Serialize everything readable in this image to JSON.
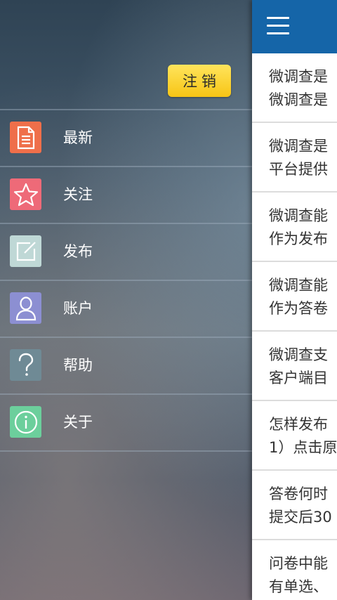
{
  "drawer": {
    "logout_label": "注销",
    "items": [
      {
        "label": "最新",
        "icon": "document-icon",
        "color": "#ef6f4a"
      },
      {
        "label": "关注",
        "icon": "star-icon",
        "color": "#ee6a78"
      },
      {
        "label": "发布",
        "icon": "edit-icon",
        "color": "#bfd8d6"
      },
      {
        "label": "账户",
        "icon": "user-icon",
        "color": "#8c8fd2"
      },
      {
        "label": "帮助",
        "icon": "help-icon",
        "color": "#6f8a95"
      },
      {
        "label": "关于",
        "icon": "info-icon",
        "color": "#6ccf9c"
      }
    ]
  },
  "content": {
    "header_color": "#1565a8",
    "faq": [
      {
        "line1": "微调查是",
        "line2": "微调查是"
      },
      {
        "line1": "微调查是",
        "line2": "平台提供"
      },
      {
        "line1": "微调查能",
        "line2": "作为发布"
      },
      {
        "line1": "微调查能",
        "line2": "作为答卷"
      },
      {
        "line1": "微调查支",
        "line2": "客户端目"
      },
      {
        "line1": "怎样发布",
        "line2": "1）点击原"
      },
      {
        "line1": "答卷何时",
        "line2": "提交后30"
      },
      {
        "line1": "问卷中能",
        "line2": "有单选、"
      }
    ]
  }
}
